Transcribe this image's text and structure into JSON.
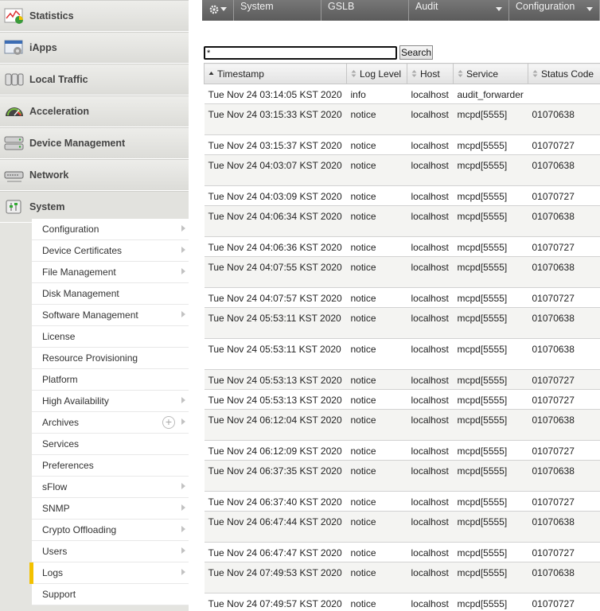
{
  "sidebar": {
    "items": [
      {
        "label": "Statistics",
        "icon": "statistics-icon"
      },
      {
        "label": "iApps",
        "icon": "iapps-icon"
      },
      {
        "label": "Local Traffic",
        "icon": "local-traffic-icon"
      },
      {
        "label": "Acceleration",
        "icon": "acceleration-icon"
      },
      {
        "label": "Device Management",
        "icon": "device-management-icon"
      },
      {
        "label": "Network",
        "icon": "network-icon"
      },
      {
        "label": "System",
        "icon": "system-icon"
      }
    ],
    "submenu": [
      {
        "label": "Configuration",
        "arrow": true
      },
      {
        "label": "Device Certificates",
        "arrow": true
      },
      {
        "label": "File Management",
        "arrow": true
      },
      {
        "label": "Disk Management",
        "arrow": false
      },
      {
        "label": "Software Management",
        "arrow": true
      },
      {
        "label": "License",
        "arrow": false
      },
      {
        "label": "Resource Provisioning",
        "arrow": false
      },
      {
        "label": "Platform",
        "arrow": false
      },
      {
        "label": "High Availability",
        "arrow": true
      },
      {
        "label": "Archives",
        "arrow": true,
        "plus": true
      },
      {
        "label": "Services",
        "arrow": false
      },
      {
        "label": "Preferences",
        "arrow": false
      },
      {
        "label": "sFlow",
        "arrow": true
      },
      {
        "label": "SNMP",
        "arrow": true
      },
      {
        "label": "Crypto Offloading",
        "arrow": true
      },
      {
        "label": "Users",
        "arrow": true
      },
      {
        "label": "Logs",
        "arrow": true,
        "selected": true
      },
      {
        "label": "Support",
        "arrow": false
      }
    ]
  },
  "topbar": {
    "menus": [
      {
        "label": "",
        "icon": "gear-icon",
        "dropdown": true
      },
      {
        "label": "System",
        "dropdown": false
      },
      {
        "label": "GSLB",
        "dropdown": false
      },
      {
        "label": "Audit",
        "dropdown": true
      },
      {
        "label": "Configuration",
        "dropdown": true
      }
    ]
  },
  "search": {
    "value": "*",
    "button_label": "Search"
  },
  "table": {
    "columns": [
      "Timestamp",
      "Log Level",
      "Host",
      "Service",
      "Status Code"
    ],
    "rows": [
      {
        "timestamp": "Tue Nov 24 03:14:05 KST 2020",
        "level": "info",
        "host": "localhost",
        "service": "audit_forwarder",
        "code": "",
        "tall": false
      },
      {
        "timestamp": "Tue Nov 24 03:15:33 KST 2020",
        "level": "notice",
        "host": "localhost",
        "service": "mcpd[5555]",
        "code": "01070638",
        "tall": true
      },
      {
        "timestamp": "Tue Nov 24 03:15:37 KST 2020",
        "level": "notice",
        "host": "localhost",
        "service": "mcpd[5555]",
        "code": "01070727",
        "tall": false
      },
      {
        "timestamp": "Tue Nov 24 04:03:07 KST 2020",
        "level": "notice",
        "host": "localhost",
        "service": "mcpd[5555]",
        "code": "01070638",
        "tall": true
      },
      {
        "timestamp": "Tue Nov 24 04:03:09 KST 2020",
        "level": "notice",
        "host": "localhost",
        "service": "mcpd[5555]",
        "code": "01070727",
        "tall": false
      },
      {
        "timestamp": "Tue Nov 24 04:06:34 KST 2020",
        "level": "notice",
        "host": "localhost",
        "service": "mcpd[5555]",
        "code": "01070638",
        "tall": true
      },
      {
        "timestamp": "Tue Nov 24 04:06:36 KST 2020",
        "level": "notice",
        "host": "localhost",
        "service": "mcpd[5555]",
        "code": "01070727",
        "tall": false
      },
      {
        "timestamp": "Tue Nov 24 04:07:55 KST 2020",
        "level": "notice",
        "host": "localhost",
        "service": "mcpd[5555]",
        "code": "01070638",
        "tall": true
      },
      {
        "timestamp": "Tue Nov 24 04:07:57 KST 2020",
        "level": "notice",
        "host": "localhost",
        "service": "mcpd[5555]",
        "code": "01070727",
        "tall": false
      },
      {
        "timestamp": "Tue Nov 24 05:53:11 KST 2020",
        "level": "notice",
        "host": "localhost",
        "service": "mcpd[5555]",
        "code": "01070638",
        "tall": true
      },
      {
        "timestamp": "Tue Nov 24 05:53:11 KST 2020",
        "level": "notice",
        "host": "localhost",
        "service": "mcpd[5555]",
        "code": "01070638",
        "tall": true
      },
      {
        "timestamp": "Tue Nov 24 05:53:13 KST 2020",
        "level": "notice",
        "host": "localhost",
        "service": "mcpd[5555]",
        "code": "01070727",
        "tall": false
      },
      {
        "timestamp": "Tue Nov 24 05:53:13 KST 2020",
        "level": "notice",
        "host": "localhost",
        "service": "mcpd[5555]",
        "code": "01070727",
        "tall": false
      },
      {
        "timestamp": "Tue Nov 24 06:12:04 KST 2020",
        "level": "notice",
        "host": "localhost",
        "service": "mcpd[5555]",
        "code": "01070638",
        "tall": true
      },
      {
        "timestamp": "Tue Nov 24 06:12:09 KST 2020",
        "level": "notice",
        "host": "localhost",
        "service": "mcpd[5555]",
        "code": "01070727",
        "tall": false
      },
      {
        "timestamp": "Tue Nov 24 06:37:35 KST 2020",
        "level": "notice",
        "host": "localhost",
        "service": "mcpd[5555]",
        "code": "01070638",
        "tall": true
      },
      {
        "timestamp": "Tue Nov 24 06:37:40 KST 2020",
        "level": "notice",
        "host": "localhost",
        "service": "mcpd[5555]",
        "code": "01070727",
        "tall": false
      },
      {
        "timestamp": "Tue Nov 24 06:47:44 KST 2020",
        "level": "notice",
        "host": "localhost",
        "service": "mcpd[5555]",
        "code": "01070638",
        "tall": true
      },
      {
        "timestamp": "Tue Nov 24 06:47:47 KST 2020",
        "level": "notice",
        "host": "localhost",
        "service": "mcpd[5555]",
        "code": "01070727",
        "tall": false
      },
      {
        "timestamp": "Tue Nov 24 07:49:53 KST 2020",
        "level": "notice",
        "host": "localhost",
        "service": "mcpd[5555]",
        "code": "01070638",
        "tall": true
      },
      {
        "timestamp": "Tue Nov 24 07:49:57 KST 2020",
        "level": "notice",
        "host": "localhost",
        "service": "mcpd[5555]",
        "code": "01070727",
        "tall": false
      }
    ]
  },
  "colors": {
    "selected_marker": "#f3c100",
    "topbar": "#666666"
  }
}
